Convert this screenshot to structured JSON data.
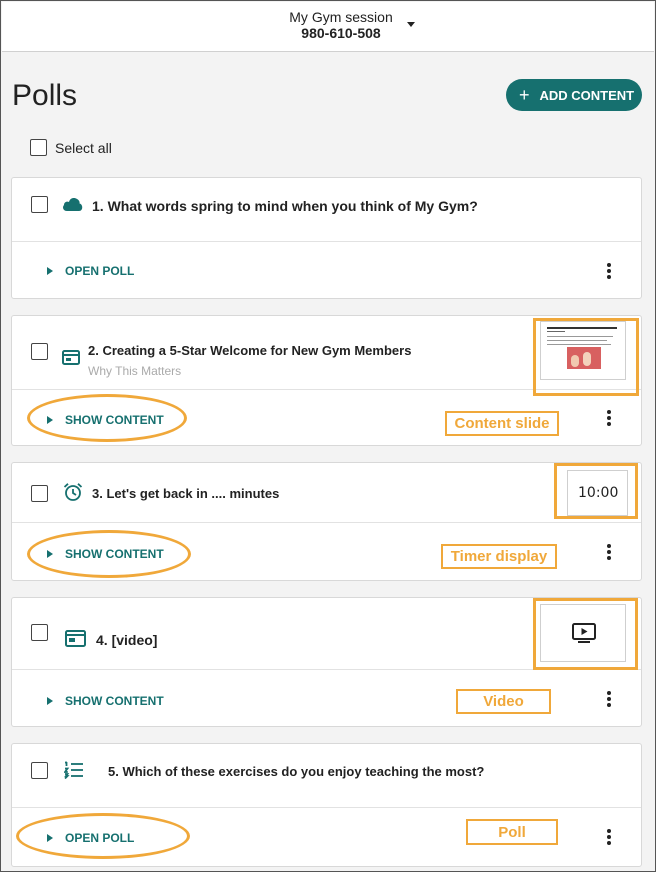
{
  "header": {
    "session_name": "My Gym session",
    "session_code": "980-610-508"
  },
  "page": {
    "title": "Polls",
    "add_button": "ADD CONTENT",
    "add_icon": "+",
    "select_all": "Select all"
  },
  "items": [
    {
      "title": "1. What words spring to mind when you think of My Gym?",
      "icon": "cloud-icon",
      "action": "OPEN POLL"
    },
    {
      "title": "2. Creating a 5-Star Welcome for New Gym Members",
      "subtitle": "Why This Matters",
      "icon": "slide-icon",
      "action": "SHOW CONTENT",
      "annotation": "Content slide"
    },
    {
      "title": "3. Let's get back in .... minutes",
      "icon": "alarm-clock-icon",
      "action": "SHOW CONTENT",
      "timer": "10:00",
      "annotation": "Timer display"
    },
    {
      "title": "4. [video]",
      "icon": "video-window-icon",
      "action": "SHOW CONTENT",
      "annotation": "Video"
    },
    {
      "title": "5. Which of these exercises do you enjoy teaching the most?",
      "icon": "list-icon",
      "action": "OPEN POLL",
      "annotation": "Poll"
    }
  ],
  "colors": {
    "accent": "#16706f",
    "highlight": "#f0a83a"
  }
}
